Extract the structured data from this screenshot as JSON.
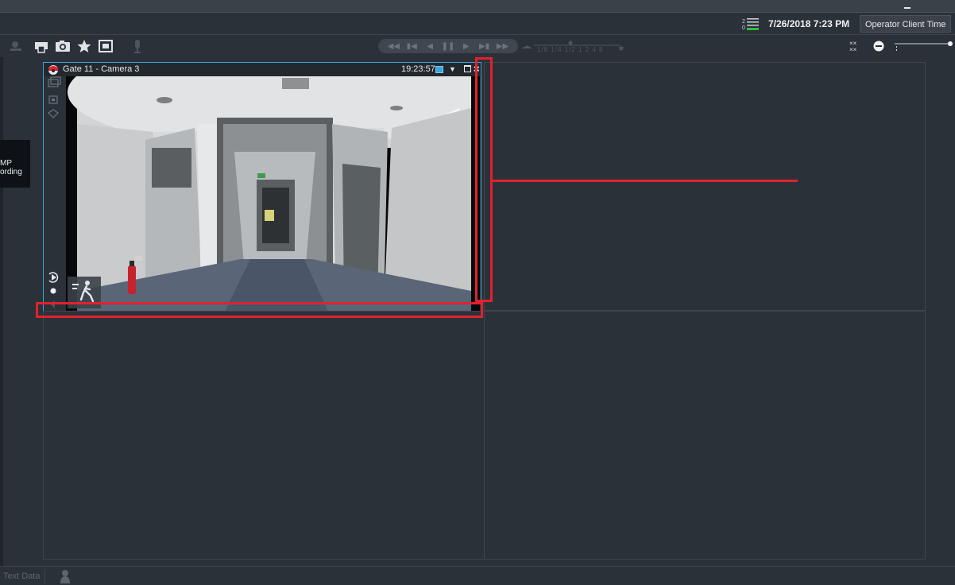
{
  "status": {
    "datetime": "7/26/2018 7:23 PM",
    "time_mode": "Operator Client Time"
  },
  "sidebar_tile": {
    "line1": "MP",
    "line2": "ording"
  },
  "camera_pane": {
    "title": "Gate 11 - Camera 3",
    "time": "19:23:57",
    "close_label": "×"
  },
  "playback": {
    "speed_labels": "1/8 1/4 1/2  1   2   4   8"
  },
  "bottom": {
    "label": "Text Data"
  },
  "colors": {
    "accent": "#3aa5dc",
    "annotation": "#e0222e",
    "background": "#2b3138",
    "status_ok": "#2fbf3a"
  },
  "icons": [
    "minimize-icon",
    "status-list-icon",
    "alarm-icon",
    "print-icon",
    "camera-snapshot-icon",
    "favorite-star-icon",
    "fullscreen-icon",
    "microphone-icon",
    "remove-icon",
    "grid-size-icon",
    "instant-playback-icon",
    "record-dot-icon",
    "motion-person-icon",
    "close-icon"
  ]
}
